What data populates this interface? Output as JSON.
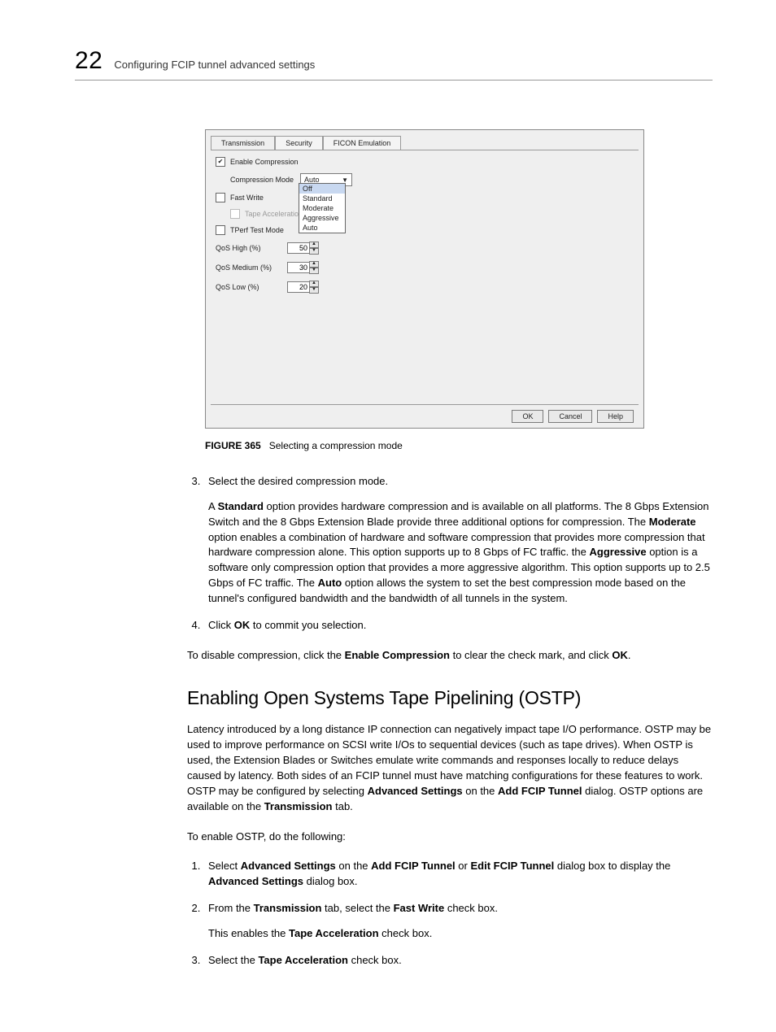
{
  "header": {
    "chapter_number": "22",
    "chapter_title": "Configuring FCIP tunnel advanced settings"
  },
  "screenshot": {
    "tabs": [
      "Transmission",
      "Security",
      "FICON Emulation"
    ],
    "active_tab": 0,
    "enable_compression": {
      "label": "Enable Compression",
      "checked": true
    },
    "compression_mode": {
      "label": "Compression Mode",
      "value": "Auto"
    },
    "dropdown_options": [
      "Off",
      "Standard",
      "Moderate",
      "Aggressive",
      "Auto"
    ],
    "dropdown_selected_index": 0,
    "fast_write": {
      "label": "Fast Write",
      "checked": false
    },
    "tape_accel": {
      "label": "Tape Acceleratio",
      "checked": false,
      "disabled": true
    },
    "tperf": {
      "label": "TPerf Test Mode",
      "checked": false
    },
    "qos_high": {
      "label": "QoS High (%)",
      "value": "50"
    },
    "qos_medium": {
      "label": "QoS Medium (%)",
      "value": "30"
    },
    "qos_low": {
      "label": "QoS Low (%)",
      "value": "20"
    },
    "buttons": {
      "ok": "OK",
      "cancel": "Cancel",
      "help": "Help"
    }
  },
  "figure": {
    "label": "FIGURE 365",
    "caption": "Selecting a compression mode"
  },
  "step3": {
    "lead": "Select the desired compression mode.",
    "para_a1": "A ",
    "standard": "Standard",
    "para_a2": " option provides hardware compression and is available on all platforms. The 8 Gbps Extension Switch and the 8 Gbps Extension Blade provide three additional options for compression. The ",
    "moderate": "Moderate",
    "para_a3": " option enables a combination of hardware and software compression that provides more compression that hardware compression alone. This option supports up to 8 Gbps of FC traffic. the ",
    "aggressive": "Aggressive",
    "para_a4": " option is a software only compression option that provides a more aggressive algorithm. This option supports up to 2.5 Gbps of FC traffic. The ",
    "auto": "Auto",
    "para_a5": " option allows the system to set the best compression mode based on the tunnel's configured bandwidth and the bandwidth of all tunnels in the system."
  },
  "step4": {
    "pre": "Click ",
    "ok": "OK",
    "post": " to commit you selection."
  },
  "disable_line": {
    "pre": "To disable compression, click the ",
    "ec": "Enable Compression",
    "mid": " to clear the check mark, and click ",
    "ok": "OK",
    "post": "."
  },
  "section_heading": "Enabling Open Systems Tape Pipelining (OSTP)",
  "ostp_para": {
    "p1": "Latency introduced by a long distance IP connection can negatively impact tape I/O performance. OSTP may be used to improve performance on SCSI write I/Os to sequential devices (such as tape drives). When OSTP is used, the Extension Blades or Switches emulate write commands and responses locally to reduce delays caused by latency. Both sides of an FCIP tunnel must have matching configurations for these features to work. OSTP may be configured by selecting ",
    "adv": "Advanced Settings",
    "p2": " on the ",
    "addft": "Add FCIP Tunnel",
    "p3": " dialog. OSTP options are available on the ",
    "trans": "Transmission",
    "p4": " tab."
  },
  "ostp_lead": "To enable OSTP, do the following:",
  "ostp_steps": {
    "s1": {
      "pre": "Select ",
      "as": "Advanced Settings",
      "mid1": " on the ",
      "aft": "Add FCIP Tunnel",
      "or": " or ",
      "eft": "Edit FCIP Tunnel",
      "mid2": " dialog box to display the ",
      "asd": "Advanced Settings",
      "post": " dialog box."
    },
    "s2": {
      "pre": "From the ",
      "trans": "Transmission",
      "mid": " tab, select the ",
      "fw": "Fast Write",
      "post": " check box.",
      "sub_pre": "This enables the ",
      "ta": "Tape Acceleration",
      "sub_post": " check box."
    },
    "s3": {
      "pre": "Select the ",
      "ta": "Tape Acceleration",
      "post": " check box."
    }
  }
}
